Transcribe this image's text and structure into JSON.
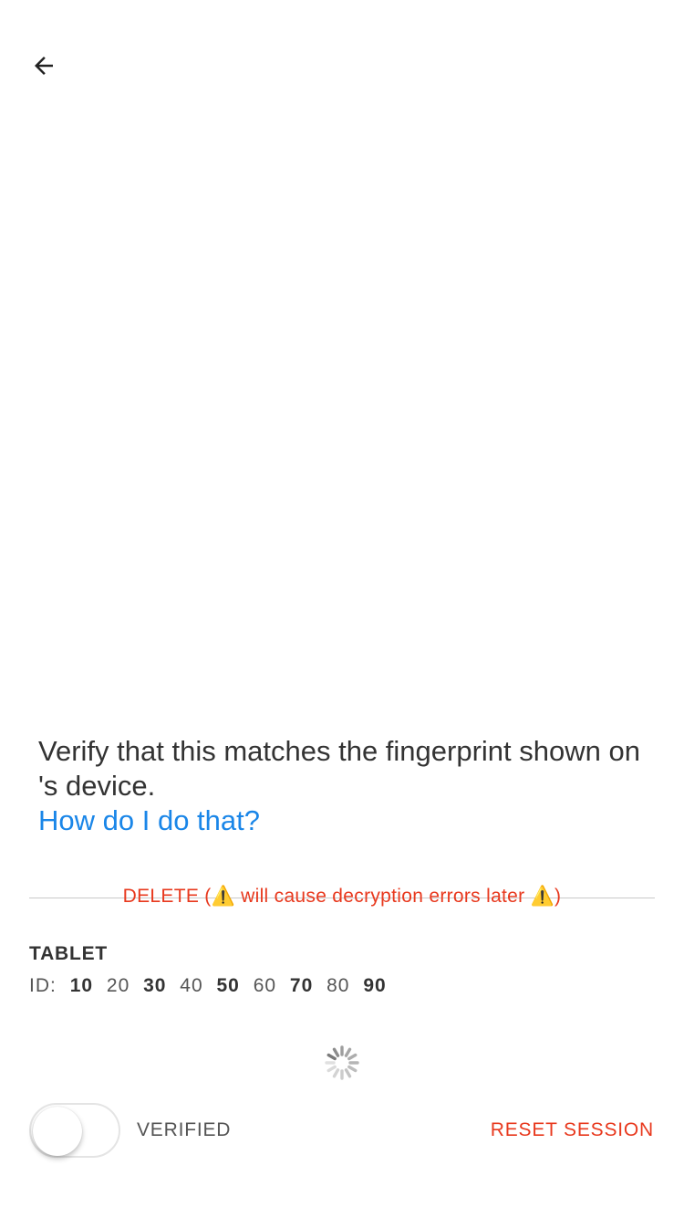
{
  "header": {
    "back_icon": "arrow-left-icon"
  },
  "verify": {
    "text": "Verify that this matches the fingerprint shown on 's device.",
    "help_link": "How do I do that?"
  },
  "delete": {
    "label": "DELETE (⚠️ will cause decryption errors later ⚠️)"
  },
  "device": {
    "name": "TABLET",
    "id_label": "ID:",
    "id_segments": [
      "10",
      "20",
      "30",
      "40",
      "50",
      "60",
      "70",
      "80",
      "90"
    ]
  },
  "footer": {
    "verified_label": "VERIFIED",
    "reset_label": "RESET SESSION"
  },
  "colors": {
    "link": "#1a86e8",
    "danger": "#e8391e"
  }
}
